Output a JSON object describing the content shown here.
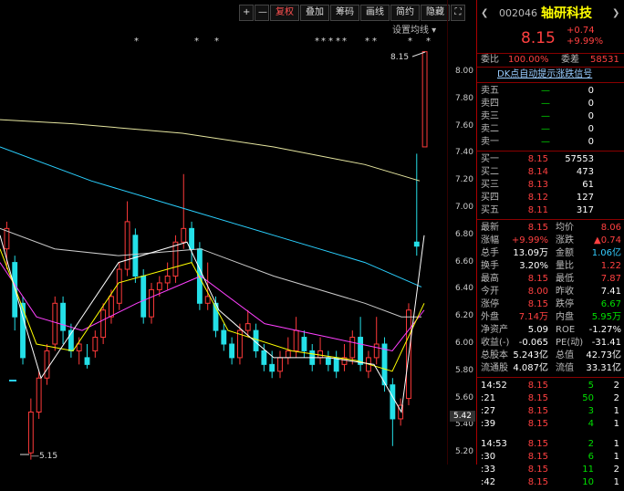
{
  "toolbar": {
    "plus": "+",
    "minus": "—",
    "fuquan": "复权",
    "diejia": "叠加",
    "chouma": "筹码",
    "huaxian": "画线",
    "jianji": "简约",
    "yincang": "隐藏",
    "expand": "⛶"
  },
  "ma_setting": "设置均线 ▾",
  "y_labels": [
    "8.00",
    "7.80",
    "7.60",
    "7.40",
    "7.20",
    "7.00",
    "6.80",
    "6.60",
    "6.40",
    "6.20",
    "6.00",
    "5.80",
    "5.60",
    "5.40",
    "5.20"
  ],
  "high_label": "8.15",
  "low_label": "5.15",
  "current_price_tag": "5.42",
  "stock": {
    "code": "002046",
    "name": "轴研科技",
    "price": "8.15",
    "change": "+0.74",
    "pct": "+9.99%"
  },
  "weibi": {
    "label": "委比",
    "value": "100.00%",
    "diff_label": "委差",
    "diff": "58531"
  },
  "signal_link": "DK点自动提示涨跌信号",
  "sell": [
    {
      "label": "卖五",
      "price": "—",
      "vol": "0"
    },
    {
      "label": "卖四",
      "price": "—",
      "vol": "0"
    },
    {
      "label": "卖三",
      "price": "—",
      "vol": "0"
    },
    {
      "label": "卖二",
      "price": "—",
      "vol": "0"
    },
    {
      "label": "卖一",
      "price": "—",
      "vol": "0"
    }
  ],
  "buy": [
    {
      "label": "买一",
      "price": "8.15",
      "vol": "57553"
    },
    {
      "label": "买二",
      "price": "8.14",
      "vol": "473"
    },
    {
      "label": "买三",
      "price": "8.13",
      "vol": "61"
    },
    {
      "label": "买四",
      "price": "8.12",
      "vol": "127"
    },
    {
      "label": "买五",
      "price": "8.11",
      "vol": "317"
    }
  ],
  "stats": [
    [
      "最新",
      "8.15",
      "red",
      "均价",
      "8.06",
      "red"
    ],
    [
      "涨幅",
      "+9.99%",
      "red",
      "涨跌",
      "▲0.74",
      "red"
    ],
    [
      "总手",
      "13.09万",
      "white",
      "金额",
      "1.06亿",
      "cyan"
    ],
    [
      "换手",
      "3.20%",
      "white",
      "量比",
      "1.22",
      "red"
    ],
    [
      "最高",
      "8.15",
      "red",
      "最低",
      "7.87",
      "red"
    ],
    [
      "今开",
      "8.00",
      "red",
      "昨收",
      "7.41",
      "white"
    ],
    [
      "涨停",
      "8.15",
      "red",
      "跌停",
      "6.67",
      "green"
    ],
    [
      "外盘",
      "7.14万",
      "red",
      "内盘",
      "5.95万",
      "green"
    ],
    [
      "净资产",
      "5.09",
      "white",
      "ROE",
      "-1.27%",
      "white"
    ],
    [
      "收益(-)",
      "-0.065",
      "white",
      "PE(动)",
      "-31.41",
      "white"
    ],
    [
      "总股本",
      "5.243亿",
      "white",
      "总值",
      "42.73亿",
      "white"
    ],
    [
      "流通股",
      "4.087亿",
      "white",
      "流值",
      "33.31亿",
      "white"
    ]
  ],
  "ticks": [
    {
      "time": "14:52",
      "price": "8.15",
      "vol": "5",
      "n": "2",
      "vc": "green"
    },
    {
      "time": ":21",
      "price": "8.15",
      "vol": "50",
      "n": "2",
      "vc": "green"
    },
    {
      "time": ":27",
      "price": "8.15",
      "vol": "3",
      "n": "1",
      "vc": "green"
    },
    {
      "time": ":39",
      "price": "8.15",
      "vol": "4",
      "n": "1",
      "vc": "green"
    },
    {
      "time": "14:53",
      "price": "8.15",
      "vol": "2",
      "n": "1",
      "vc": "green"
    },
    {
      "time": ":30",
      "price": "8.15",
      "vol": "6",
      "n": "1",
      "vc": "green"
    },
    {
      "time": ":33",
      "price": "8.15",
      "vol": "11",
      "n": "2",
      "vc": "green"
    },
    {
      "time": ":42",
      "price": "8.15",
      "vol": "10",
      "n": "1",
      "vc": "green"
    }
  ]
}
